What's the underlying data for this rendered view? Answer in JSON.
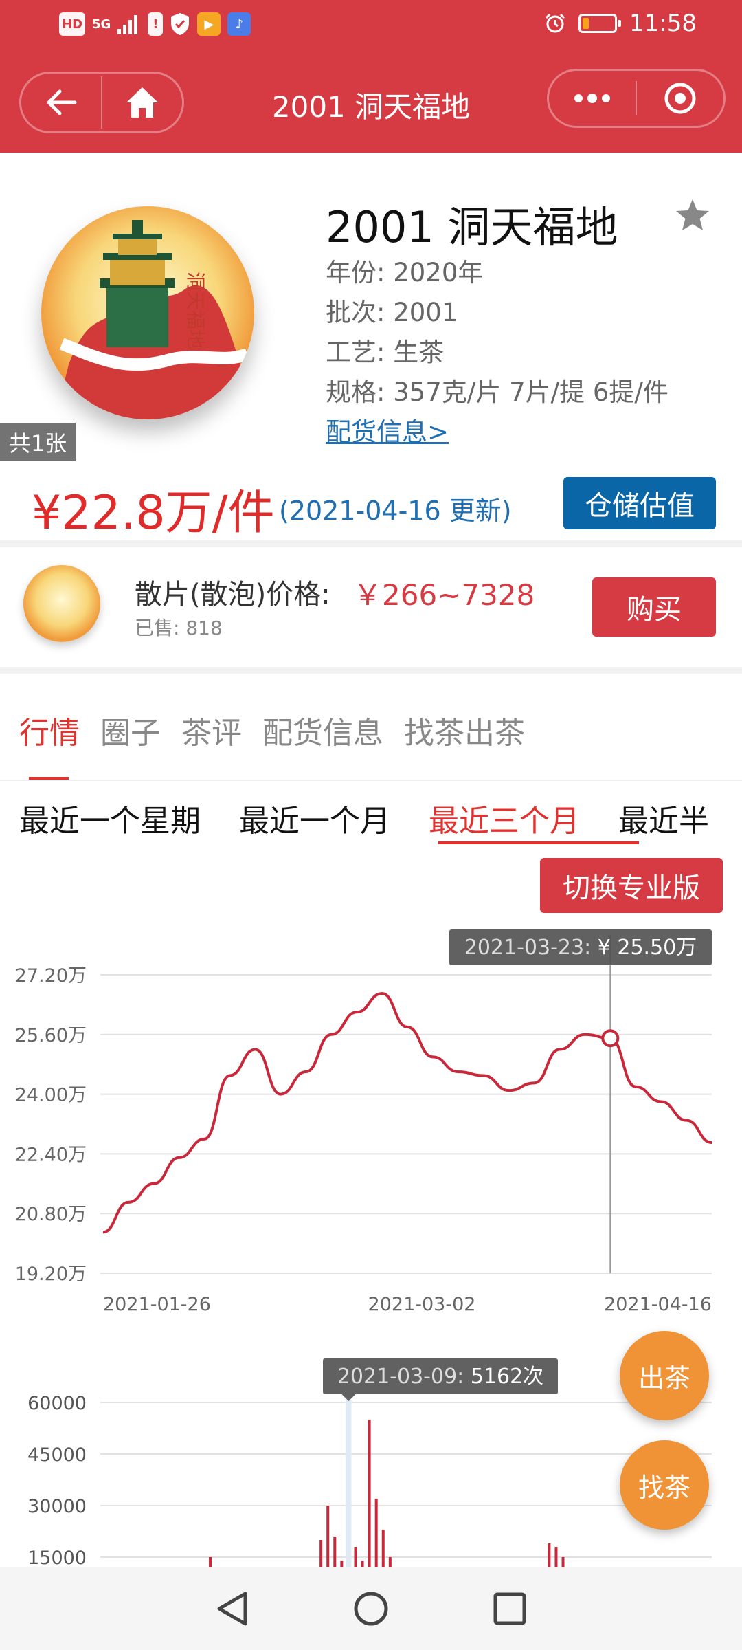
{
  "status_bar": {
    "left_icons": [
      "HD",
      "5G"
    ],
    "time": "11:58",
    "battery_level": 0.2
  },
  "nav": {
    "title": "2001 洞天福地"
  },
  "product": {
    "title": "2001 洞天福地",
    "year_line": "年份: 2020年",
    "batch_line": "批次: 2001",
    "craft_line": "工艺: 生茶",
    "spec_line": "规格: 357克/片 7片/提 6提/件",
    "distribution_link": "配货信息>",
    "photo_count": "共1张",
    "price": "¥22.8万/件",
    "price_updated": "(2021-04-16 更新)",
    "storage_button": "仓储估值"
  },
  "loose": {
    "label": "散片(散泡)价格:",
    "price_range": "￥266~7328",
    "sold": "已售: 818",
    "buy_button": "购买"
  },
  "tabs": [
    "行情",
    "圈子",
    "茶评",
    "配货信息",
    "找茶出茶"
  ],
  "active_tab": 0,
  "periods": [
    "最近一个星期",
    "最近一个月",
    "最近三个月",
    "最近半"
  ],
  "active_period": 2,
  "pro_button": "切换专业版",
  "fab": {
    "sell": "出茶",
    "find": "找茶"
  },
  "colors": {
    "brand_red": "#d63a42",
    "price_red": "#e02b2b",
    "link_blue": "#1f6fb2",
    "store_blue": "#0b66a8",
    "fab_orange": "#f09236",
    "line_red": "#c8283a"
  },
  "chart_data": [
    {
      "type": "line",
      "yticks": [
        "27.20万",
        "25.60万",
        "24.00万",
        "22.40万",
        "20.80万",
        "19.20万"
      ],
      "ylim": [
        19.2,
        27.2
      ],
      "xticks": [
        "2021-01-26",
        "2021-03-02",
        "2021-04-16"
      ],
      "tooltip": {
        "date": "2021-03-23",
        "sep": ": ",
        "value": "¥ 25.50万"
      },
      "highlight_index": 20,
      "series": [
        {
          "values": [
            20.3,
            21.1,
            21.6,
            22.3,
            22.8,
            24.5,
            25.2,
            24.0,
            24.6,
            25.6,
            26.2,
            26.7,
            25.8,
            25.0,
            24.6,
            24.5,
            24.1,
            24.3,
            25.2,
            25.6,
            25.5,
            24.2,
            23.8,
            23.3,
            22.7
          ]
        }
      ]
    },
    {
      "type": "bar",
      "yticks": [
        "60000",
        "45000",
        "30000",
        "15000"
      ],
      "ylim": [
        0,
        60000
      ],
      "tooltip": {
        "date": "2021-03-09",
        "sep": ": ",
        "value": "5162次"
      },
      "highlight_index": 35,
      "series": [
        {
          "values": [
            800,
            0,
            0,
            0,
            0,
            0,
            0,
            0,
            1500,
            0,
            0,
            0,
            900,
            0,
            0,
            15000,
            2500,
            0,
            5500,
            1000,
            2800,
            0,
            0,
            0,
            0,
            0,
            0,
            0,
            0,
            0,
            3000,
            20000,
            30000,
            21000,
            14000,
            5162,
            18000,
            14000,
            55000,
            32000,
            23000,
            15000,
            5000,
            0,
            0,
            0,
            0,
            1500,
            0,
            0,
            0,
            0,
            1000,
            0,
            0,
            0,
            0,
            0,
            0,
            0,
            0,
            0,
            0,
            0,
            19000,
            18000,
            15000,
            10000,
            7000,
            4500,
            3500,
            3000,
            0,
            0,
            0,
            0,
            0,
            0,
            0,
            0,
            0,
            0,
            1200,
            0,
            0,
            0,
            0,
            0
          ]
        }
      ]
    }
  ]
}
